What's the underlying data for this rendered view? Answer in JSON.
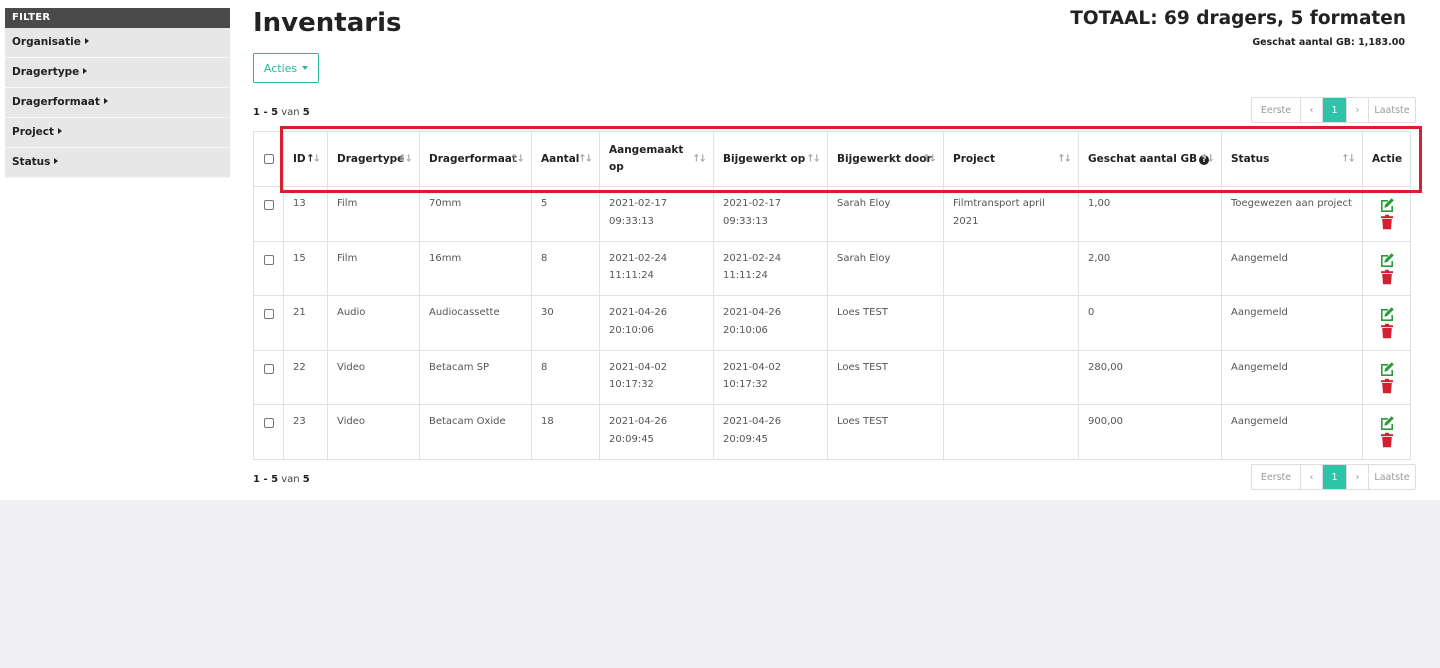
{
  "sidebar": {
    "header": "FILTER",
    "items": [
      {
        "label": "Organisatie"
      },
      {
        "label": "Dragertype"
      },
      {
        "label": "Dragerformaat"
      },
      {
        "label": "Project"
      },
      {
        "label": "Status"
      }
    ]
  },
  "header": {
    "title": "Inventaris",
    "totaal": "TOTAAL: 69 dragers, 5 formaten",
    "geschat": "Geschat aantal GB: 1,183.00"
  },
  "acties_label": "Acties",
  "count": {
    "range": "1 - 5",
    "van": "van",
    "total": "5"
  },
  "pager": {
    "first": "Eerste",
    "prev": "‹",
    "current": "1",
    "next": "›",
    "last": "Laatste"
  },
  "table": {
    "headers": {
      "id": "ID",
      "dragertype": "Dragertype",
      "dragerformaat": "Dragerformaat",
      "aantal": "Aantal",
      "aangemaakt_1": "Aangemaakt",
      "aangemaakt_2": "op",
      "bijgewerkt_op": "Bijgewerkt op",
      "bijgewerkt_door": "Bijgewerkt door",
      "project": "Project",
      "geschat": "Geschat aantal GB",
      "status": "Status",
      "actie": "Actie"
    },
    "rows": [
      {
        "id": "13",
        "dragertype": "Film",
        "dragerformaat": "70mm",
        "aantal": "5",
        "aangemaakt_1": "2021-02-17",
        "aangemaakt_2": "09:33:13",
        "bijgewerkt_1": "2021-02-17",
        "bijgewerkt_2": "09:33:13",
        "door": "Sarah Eloy",
        "project_1": "Filmtransport april",
        "project_2": "2021",
        "gb": "1,00",
        "status": "Toegewezen aan project"
      },
      {
        "id": "15",
        "dragertype": "Film",
        "dragerformaat": "16mm",
        "aantal": "8",
        "aangemaakt_1": "2021-02-24 11:11:24",
        "aangemaakt_2": "",
        "bijgewerkt_1": "2021-02-24 11:11:24",
        "bijgewerkt_2": "",
        "door": "Sarah Eloy",
        "project_1": "",
        "project_2": "",
        "gb": "2,00",
        "status": "Aangemeld"
      },
      {
        "id": "21",
        "dragertype": "Audio",
        "dragerformaat": "Audiocassette",
        "aantal": "30",
        "aangemaakt_1": "2021-04-26",
        "aangemaakt_2": "20:10:06",
        "bijgewerkt_1": "2021-04-26",
        "bijgewerkt_2": "20:10:06",
        "door": "Loes TEST",
        "project_1": "",
        "project_2": "",
        "gb": "0",
        "status": "Aangemeld"
      },
      {
        "id": "22",
        "dragertype": "Video",
        "dragerformaat": "Betacam SP",
        "aantal": "8",
        "aangemaakt_1": "2021-04-02",
        "aangemaakt_2": "10:17:32",
        "bijgewerkt_1": "2021-04-02",
        "bijgewerkt_2": "10:17:32",
        "door": "Loes TEST",
        "project_1": "",
        "project_2": "",
        "gb": "280,00",
        "status": "Aangemeld"
      },
      {
        "id": "23",
        "dragertype": "Video",
        "dragerformaat": "Betacam Oxide",
        "aantal": "18",
        "aangemaakt_1": "2021-04-26",
        "aangemaakt_2": "20:09:45",
        "bijgewerkt_1": "2021-04-26",
        "bijgewerkt_2": "20:09:45",
        "door": "Loes TEST",
        "project_1": "",
        "project_2": "",
        "gb": "900,00",
        "status": "Aangemeld"
      }
    ]
  },
  "icons": {
    "edit": "edit-icon",
    "delete": "trash-icon",
    "help": "question-circle-icon"
  },
  "colors": {
    "accent": "#2ec4a8",
    "edit": "#2a9d3a",
    "delete": "#d42030",
    "highlight": "#d42030"
  }
}
